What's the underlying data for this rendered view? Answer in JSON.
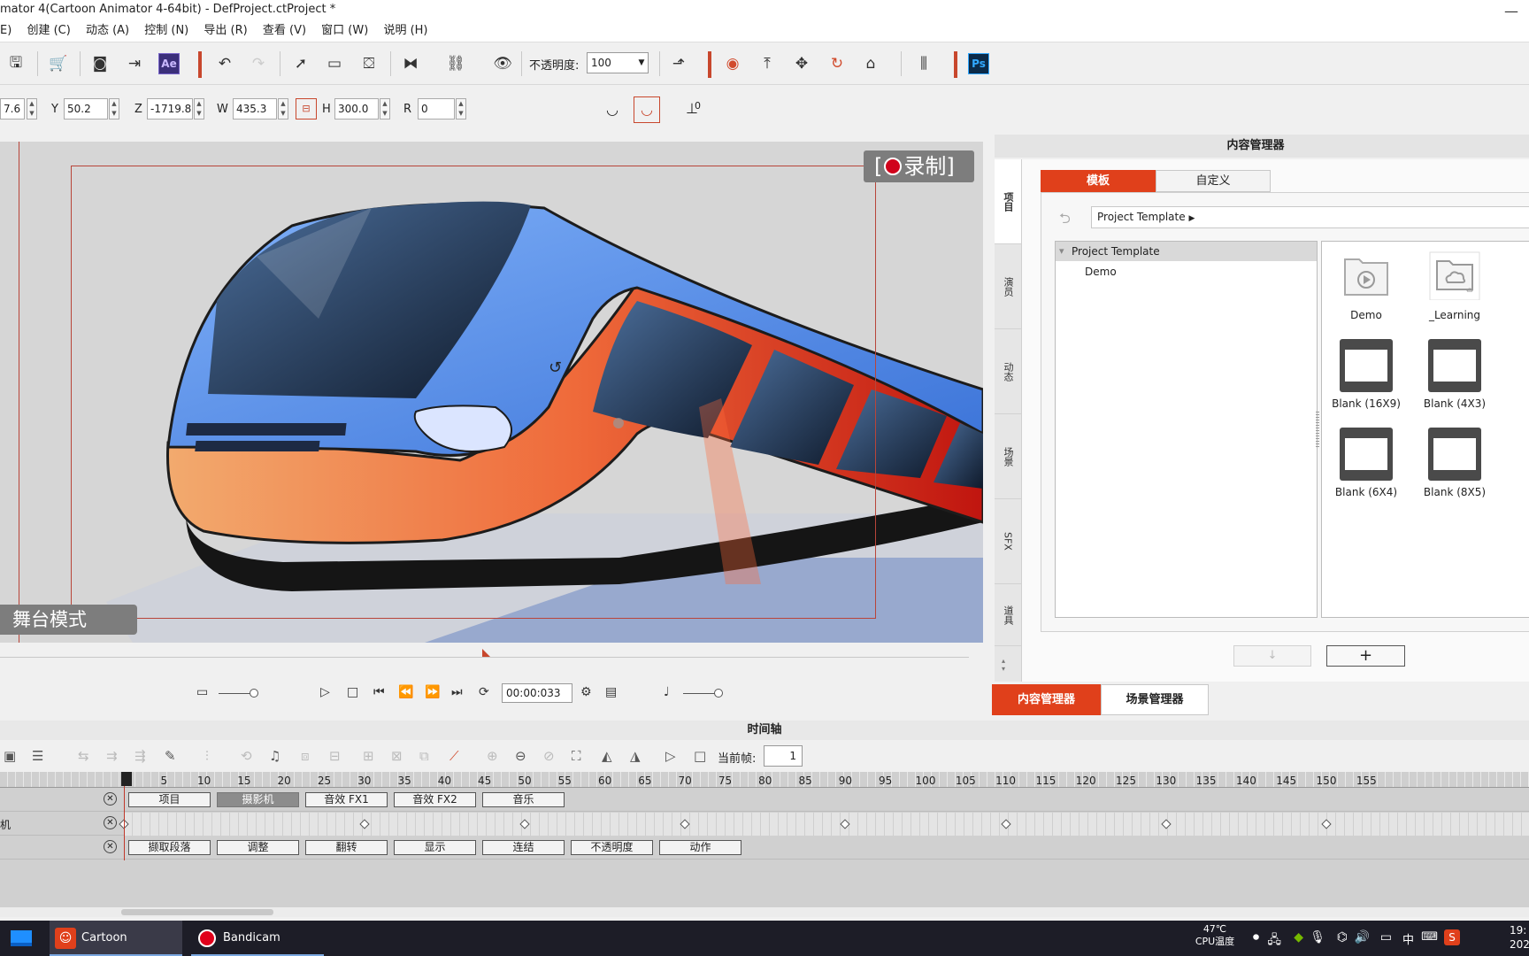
{
  "window": {
    "title": "mator 4(Cartoon Animator 4-64bit) - DefProject.ctProject *"
  },
  "menu": [
    "E)",
    "创建 (C)",
    "动态 (A)",
    "控制 (N)",
    "导出 (R)",
    "查看 (V)",
    "窗口 (W)",
    "说明 (H)"
  ],
  "toolbar": {
    "opacity_label": "不透明度:",
    "opacity_value": "100",
    "ae_label": "Ae",
    "ps_label": "Ps"
  },
  "transform": {
    "x_value": "7.6",
    "y_label": "Y",
    "y_value": "50.2",
    "z_label": "Z",
    "z_value": "-1719.8",
    "w_label": "W",
    "w_value": "435.3",
    "h_label": "H",
    "h_value": "300.0",
    "r_label": "R",
    "r_value": "0",
    "extra_value": "0"
  },
  "viewport": {
    "record_label": "录制",
    "stage_mode_label": "舞台模式"
  },
  "playback": {
    "timecode": "00:00:033"
  },
  "content_manager": {
    "header": "内容管理器",
    "vertical_tabs": [
      "项目",
      "演员",
      "动态",
      "场景",
      "SFX",
      "道具"
    ],
    "tabs": [
      "模板",
      "自定义"
    ],
    "path": "Project Template",
    "tree": {
      "root": "Project Template",
      "children": [
        "Demo"
      ]
    },
    "items": [
      "Demo",
      "_Learning",
      "Blank (16X9)",
      "Blank (4X3)",
      "Blank (6X4)",
      "Blank (8X5)"
    ],
    "plus_label": "+"
  },
  "bottom_tabs": [
    "内容管理器",
    "场景管理器"
  ],
  "timeline": {
    "header": "时间轴",
    "current_frame_label": "当前帧:",
    "current_frame": "1",
    "ruler": [
      "5",
      "10",
      "15",
      "20",
      "25",
      "30",
      "35",
      "40",
      "45",
      "50",
      "55",
      "60",
      "65",
      "70",
      "75",
      "80",
      "85",
      "90",
      "95",
      "100",
      "105",
      "110",
      "115",
      "120",
      "125",
      "130",
      "135",
      "140",
      "145",
      "150",
      "155"
    ],
    "row1_label": "",
    "row1_buttons": [
      "项目",
      "摄影机",
      "音效 FX1",
      "音效 FX2",
      "音乐"
    ],
    "row1_selected": "摄影机",
    "row2_label": "机",
    "row3_label": "",
    "row3_buttons": [
      "撷取段落",
      "调整",
      "翻转",
      "显示",
      "连结",
      "不透明度",
      "动作"
    ]
  },
  "taskbar": {
    "apps": [
      "Cartoon Animato...",
      "Bandicam"
    ],
    "temp": "47℃",
    "cpu_label": "CPU温度",
    "lang": "中",
    "clock_time": "19:",
    "clock_date": "202"
  },
  "colors": {
    "accent": "#e0401b",
    "record_dot": "#d0021b",
    "stage_border": "#b8453a"
  }
}
